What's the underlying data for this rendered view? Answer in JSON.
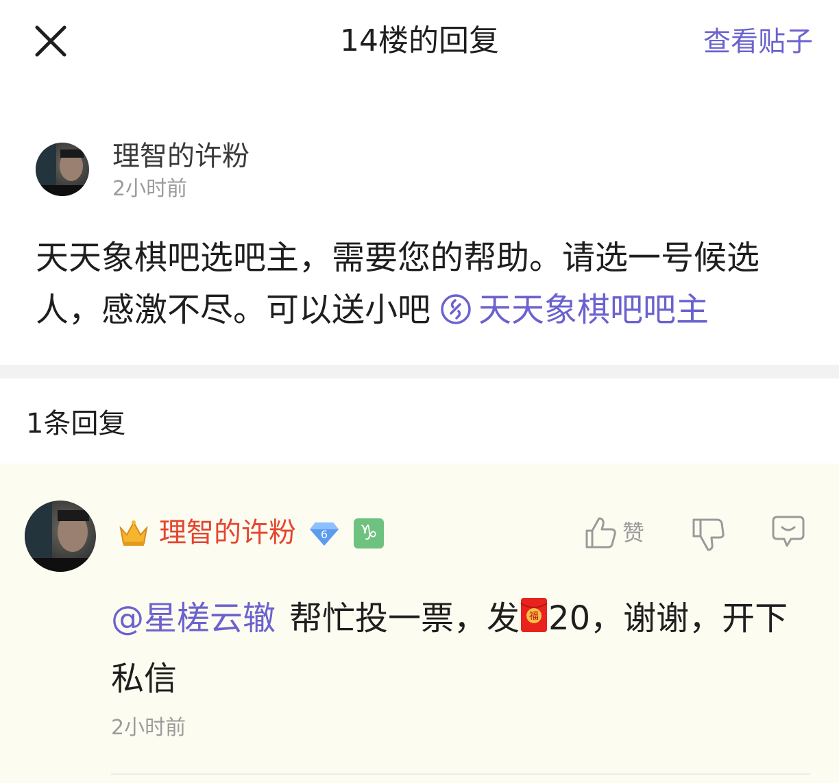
{
  "header": {
    "title": "14楼的回复",
    "view_post_label": "查看贴子"
  },
  "post": {
    "username": "理智的许粉",
    "time": "2小时前",
    "text": "天天象棋吧选吧主，需要您的帮助。请选一号候选人，感激不尽。可以送小吧",
    "link_text": "天天象棋吧吧主"
  },
  "replies_header": "1条回复",
  "reply": {
    "username": "理智的许粉",
    "level": "6",
    "zodiac": "♑",
    "like_label": "赞",
    "mention": "@星槎云辙",
    "text_before_envelope": "帮忙投一票，发",
    "envelope_char": "福",
    "text_after_envelope": "20，谢谢，开下私信",
    "time": "2小时前"
  },
  "colors": {
    "accent": "#6b62cf",
    "username_red": "#e5452f",
    "reply_bg": "#fdfcf1",
    "divider": "#f2f2f2",
    "meta_gray": "#9b9b9b"
  },
  "icons": [
    "close-icon",
    "link-icon",
    "crown-icon",
    "diamond-level-icon",
    "capricorn-icon",
    "thumbs-up-icon",
    "thumbs-down-icon",
    "comment-icon",
    "red-envelope-icon"
  ]
}
